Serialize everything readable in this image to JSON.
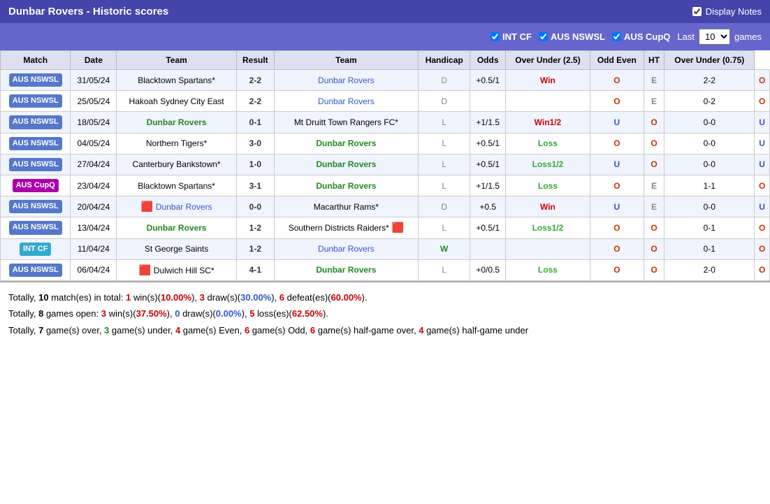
{
  "header": {
    "title": "Dunbar Rovers - Historic scores",
    "display_notes_label": "Display Notes"
  },
  "filters": {
    "int_cf_label": "INT CF",
    "aus_nswsl_label": "AUS NSWSL",
    "aus_cupq_label": "AUS CupQ",
    "last_label": "Last",
    "games_label": "games",
    "last_value": "10"
  },
  "table": {
    "columns": [
      "Match",
      "Date",
      "Team",
      "Result",
      "Team",
      "Handicap",
      "Odds",
      "Over Under (2.5)",
      "Odd Even",
      "HT",
      "Over Under (0.75)"
    ],
    "rows": [
      {
        "badge": "AUS NSWSL",
        "badge_type": "nswsl",
        "date": "31/05/24",
        "team1": "Blacktown Spartans*",
        "team1_type": "normal",
        "result": "2-2",
        "team2": "Dunbar Rovers",
        "team2_type": "blue",
        "letter": "D",
        "handicap": "+0.5/1",
        "odds": "Win",
        "ou": "O",
        "oe": "E",
        "ht": "2-2",
        "ou075": "O"
      },
      {
        "badge": "AUS NSWSL",
        "badge_type": "nswsl",
        "date": "25/05/24",
        "team1": "Hakoah Sydney City East",
        "team1_type": "normal",
        "result": "2-2",
        "team2": "Dunbar Rovers",
        "team2_type": "blue",
        "letter": "D",
        "handicap": "",
        "odds": "",
        "ou": "O",
        "oe": "E",
        "ht": "0-2",
        "ou075": "O"
      },
      {
        "badge": "AUS NSWSL",
        "badge_type": "nswsl",
        "date": "18/05/24",
        "team1": "Dunbar Rovers",
        "team1_type": "green",
        "result": "0-1",
        "team2": "Mt Druitt Town Rangers FC*",
        "team2_type": "normal",
        "letter": "L",
        "handicap": "+1/1.5",
        "odds": "Win1/2",
        "ou": "U",
        "oe": "O",
        "ht": "0-0",
        "ou075": "U"
      },
      {
        "badge": "AUS NSWSL",
        "badge_type": "nswsl",
        "date": "04/05/24",
        "team1": "Northern Tigers*",
        "team1_type": "normal",
        "result": "3-0",
        "team2": "Dunbar Rovers",
        "team2_type": "green",
        "letter": "L",
        "handicap": "+0.5/1",
        "odds": "Loss",
        "ou": "O",
        "oe": "O",
        "ht": "0-0",
        "ou075": "U"
      },
      {
        "badge": "AUS NSWSL",
        "badge_type": "nswsl",
        "date": "27/04/24",
        "team1": "Canterbury Bankstown*",
        "team1_type": "normal",
        "result": "1-0",
        "team2": "Dunbar Rovers",
        "team2_type": "green",
        "letter": "L",
        "handicap": "+0.5/1",
        "odds": "Loss1/2",
        "ou": "U",
        "oe": "O",
        "ht": "0-0",
        "ou075": "U"
      },
      {
        "badge": "AUS CupQ",
        "badge_type": "cupq",
        "date": "23/04/24",
        "team1": "Blacktown Spartans*",
        "team1_type": "normal",
        "result": "3-1",
        "team2": "Dunbar Rovers",
        "team2_type": "green",
        "letter": "L",
        "handicap": "+1/1.5",
        "odds": "Loss",
        "ou": "O",
        "oe": "E",
        "ht": "1-1",
        "ou075": "O"
      },
      {
        "badge": "AUS NSWSL",
        "badge_type": "nswsl",
        "date": "20/04/24",
        "team1": "Dunbar Rovers",
        "team1_type": "blue",
        "team1_redcard": true,
        "result": "0-0",
        "team2": "Macarthur Rams*",
        "team2_type": "normal",
        "letter": "D",
        "handicap": "+0.5",
        "odds": "Win",
        "ou": "U",
        "oe": "E",
        "ht": "0-0",
        "ou075": "U"
      },
      {
        "badge": "AUS NSWSL",
        "badge_type": "nswsl",
        "date": "13/04/24",
        "team1": "Dunbar Rovers",
        "team1_type": "green",
        "result": "1-2",
        "team2": "Southern Districts Raiders*",
        "team2_type": "normal",
        "team2_redcard": true,
        "letter": "L",
        "handicap": "+0.5/1",
        "odds": "Loss1/2",
        "ou": "O",
        "oe": "O",
        "ht": "0-1",
        "ou075": "O"
      },
      {
        "badge": "INT CF",
        "badge_type": "intcf",
        "date": "11/04/24",
        "team1": "St George Saints",
        "team1_type": "normal",
        "result": "1-2",
        "team2": "Dunbar Rovers",
        "team2_type": "blue",
        "letter": "W",
        "handicap": "",
        "odds": "",
        "ou": "O",
        "oe": "O",
        "ht": "0-1",
        "ou075": "O"
      },
      {
        "badge": "AUS NSWSL",
        "badge_type": "nswsl",
        "date": "06/04/24",
        "team1": "Dulwich Hill SC*",
        "team1_type": "normal",
        "team1_redcard": true,
        "result": "4-1",
        "team2": "Dunbar Rovers",
        "team2_type": "green",
        "letter": "L",
        "handicap": "+0/0.5",
        "odds": "Loss",
        "ou": "O",
        "oe": "O",
        "ht": "2-0",
        "ou075": "O"
      }
    ]
  },
  "summary": [
    "Totally, <b>10</b> match(es) in total: <b><red>1</red></b> win(s)(<red>10.00%</red>), <b><red>3</red></b> draw(s)(<blue>30.00%</blue>), <b><red>6</red></b> defeat(es)(<red>60.00%</red>).",
    "Totally, <b>8</b> games open: <b><red>3</red></b> win(s)(<red>37.50%</red>), <b><blue>0</blue></b> draw(s)(<blue>0.00%</blue>), <b><red>5</red></b> loss(es)(<red>62.50%</red>).",
    "Totally, <b>7</b> game(s) over, <b><green>3</green></b> game(s) under, <b><red>4</red></b> game(s) Even, <b><red>6</red></b> game(s) Odd, <b><red>6</red></b> game(s) half-game over, <b><red>4</red></b> game(s) half-game under"
  ]
}
